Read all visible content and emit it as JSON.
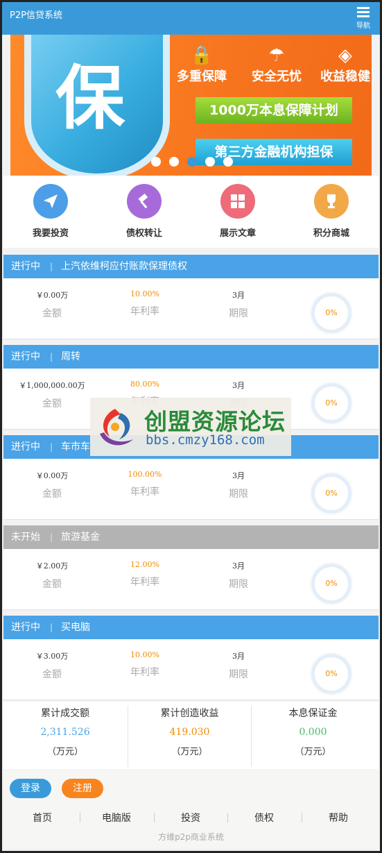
{
  "header": {
    "title": "P2P信贷系统",
    "nav_label": "导航"
  },
  "banner": {
    "shield_char": "保",
    "features": [
      {
        "label": "多重保障",
        "icon": "lock-icon",
        "glyph": "🔒"
      },
      {
        "label": "安全无忧",
        "icon": "umbrella-icon",
        "glyph": "☂"
      },
      {
        "label": "收益稳健",
        "icon": "diamond-icon",
        "glyph": "◈"
      }
    ],
    "plan_text": "1000万本息保障计划",
    "guarantee_text": "第三方金融机构担保",
    "slide_count": 5,
    "active_slide": 3
  },
  "quick_menu": [
    {
      "label": "我要投资",
      "icon": "paper-plane-icon",
      "color": "#4d9ee8"
    },
    {
      "label": "债权转让",
      "icon": "gavel-icon",
      "color": "#a66bd9"
    },
    {
      "label": "展示文章",
      "icon": "grid-icon",
      "color": "#ee6b7a"
    },
    {
      "label": "积分商城",
      "icon": "trophy-icon",
      "color": "#f3a847"
    }
  ],
  "products": [
    {
      "status": "进行中",
      "name": "上汽依维柯应付账款保理债权",
      "amount": "￥0.00万",
      "rate": "10.00%",
      "term": "3月",
      "progress": "0%",
      "status_type": "active"
    },
    {
      "status": "进行中",
      "name": "周转",
      "amount": "￥1,000,000.00万",
      "rate": "80.00%",
      "term": "3月",
      "progress": "0%",
      "status_type": "active"
    },
    {
      "status": "进行中",
      "name": "车市车",
      "amount": "￥0.00万",
      "rate": "100.00%",
      "term": "3月",
      "progress": "0%",
      "status_type": "active"
    },
    {
      "status": "未开始",
      "name": "旅游基金",
      "amount": "￥2.00万",
      "rate": "12.00%",
      "term": "3月",
      "progress": "0%",
      "status_type": "pending"
    },
    {
      "status": "进行中",
      "name": "买电脑",
      "amount": "￥3.00万",
      "rate": "10.00%",
      "term": "3月",
      "progress": "0%",
      "status_type": "active"
    }
  ],
  "field_labels": {
    "amount": "金额",
    "rate": "年利率",
    "term": "期限"
  },
  "stats": [
    {
      "title": "累计成交额",
      "value": "2,311.526",
      "unit": "（万元）",
      "color": "#4aa3e6"
    },
    {
      "title": "累计创造收益",
      "value": "419.030",
      "unit": "（万元）",
      "color": "#f08c00"
    },
    {
      "title": "本息保证金",
      "value": "0.000",
      "unit": "（万元）",
      "color": "#49b86a"
    }
  ],
  "footer": {
    "login": "登录",
    "register": "注册",
    "links": [
      "首页",
      "电脑版",
      "投资",
      "债权",
      "帮助"
    ],
    "copyright": "方维p2p商业系统"
  },
  "watermark": {
    "title": "创盟资源论坛",
    "url": "bbs.cmzy168.com"
  },
  "colors": {
    "primary": "#3a9ad9",
    "orange": "#f08c00",
    "gray_bar": "#b3b3b3"
  }
}
